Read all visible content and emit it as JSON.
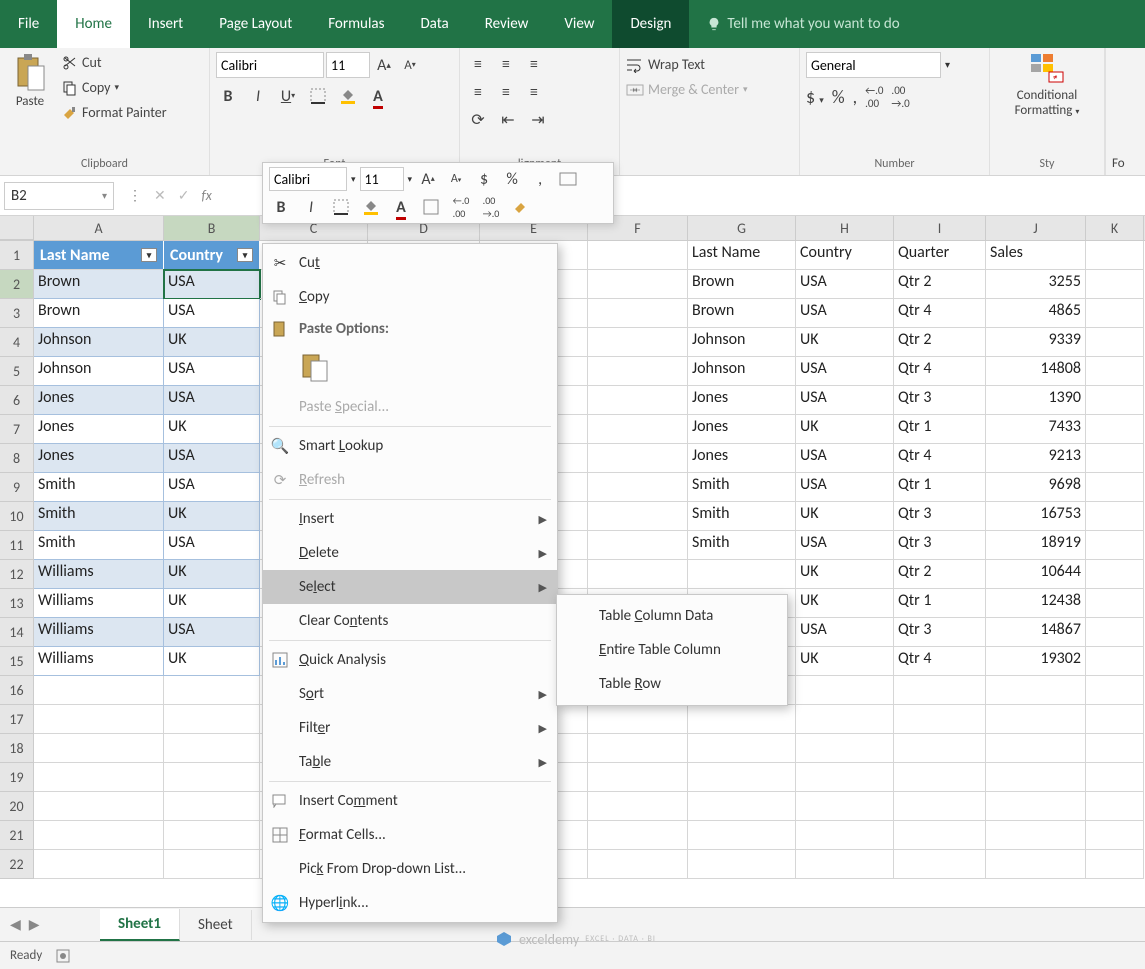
{
  "tabs": [
    "File",
    "Home",
    "Insert",
    "Page Layout",
    "Formulas",
    "Data",
    "Review",
    "View",
    "Design"
  ],
  "tellme": "Tell me what you want to do",
  "clipboard": {
    "paste": "Paste",
    "cut": "Cut",
    "copy": "Copy",
    "format_painter": "Format Painter",
    "group": "Clipboard"
  },
  "font": {
    "name": "Calibri",
    "size": "11",
    "group": "Font"
  },
  "alignment_group": "lignment",
  "wrap": {
    "wrap": "Wrap Text",
    "merge": "Merge & Center"
  },
  "number": {
    "format": "General",
    "group": "Number"
  },
  "styles": {
    "cond1": "Conditional",
    "cond2": "Formatting",
    "grp": "Sty"
  },
  "name_box": "B2",
  "table_headers": {
    "A": "Last Name",
    "B": "Country"
  },
  "table_rows": [
    {
      "A": "Brown",
      "B": "USA"
    },
    {
      "A": "Brown",
      "B": "USA"
    },
    {
      "A": "Johnson",
      "B": "UK"
    },
    {
      "A": "Johnson",
      "B": "USA"
    },
    {
      "A": "Jones",
      "B": "USA"
    },
    {
      "A": "Jones",
      "B": "UK"
    },
    {
      "A": "Jones",
      "B": "USA"
    },
    {
      "A": "Smith",
      "B": "USA"
    },
    {
      "A": "Smith",
      "B": "UK"
    },
    {
      "A": "Smith",
      "B": "USA"
    },
    {
      "A": "Williams",
      "B": "UK"
    },
    {
      "A": "Williams",
      "B": "UK"
    },
    {
      "A": "Williams",
      "B": "USA"
    },
    {
      "A": "Williams",
      "B": "UK"
    }
  ],
  "plain_headers": {
    "F": "Last Name",
    "G": "Country",
    "H": "Quarter",
    "I": "Sales"
  },
  "plain_rows": [
    {
      "F": "Brown",
      "G": "USA",
      "H": "Qtr 2",
      "I": "3255"
    },
    {
      "F": "Brown",
      "G": "USA",
      "H": "Qtr 4",
      "I": "4865"
    },
    {
      "F": "Johnson",
      "G": "UK",
      "H": "Qtr 2",
      "I": "9339"
    },
    {
      "F": "Johnson",
      "G": "USA",
      "H": "Qtr 4",
      "I": "14808"
    },
    {
      "F": "Jones",
      "G": "USA",
      "H": "Qtr 3",
      "I": "1390"
    },
    {
      "F": "Jones",
      "G": "UK",
      "H": "Qtr 1",
      "I": "7433"
    },
    {
      "F": "Jones",
      "G": "USA",
      "H": "Qtr 4",
      "I": "9213"
    },
    {
      "F": "Smith",
      "G": "USA",
      "H": "Qtr 1",
      "I": "9698"
    },
    {
      "F": "Smith",
      "G": "UK",
      "H": "Qtr 3",
      "I": "16753"
    },
    {
      "F": "Smith",
      "G": "USA",
      "H": "Qtr 3",
      "I": "18919"
    },
    {
      "F": "",
      "G": "UK",
      "H": "Qtr 2",
      "I": "10644"
    },
    {
      "F": "",
      "G": "UK",
      "H": "Qtr 1",
      "I": "12438"
    },
    {
      "F": "",
      "G": "USA",
      "H": "Qtr 3",
      "I": "14867"
    },
    {
      "F": "",
      "G": "UK",
      "H": "Qtr 4",
      "I": "19302"
    }
  ],
  "cols": [
    "A",
    "B",
    "C",
    "D",
    "E",
    "F",
    "G",
    "H",
    "I",
    "J",
    "K"
  ],
  "mini": {
    "font": "Calibri",
    "size": "11"
  },
  "context": {
    "cut": "Cut",
    "copy": "Copy",
    "paste_options": "Paste Options:",
    "paste_special": "Paste Special...",
    "smart_lookup": "Smart Lookup",
    "refresh": "Refresh",
    "insert": "Insert",
    "delete": "Delete",
    "select": "Select",
    "clear": "Clear Contents",
    "quick": "Quick Analysis",
    "sort": "Sort",
    "filter": "Filter",
    "table": "Table",
    "comment": "Insert Comment",
    "format_cells": "Format Cells...",
    "pick": "Pick From Drop-down List...",
    "hyperlink": "Hyperlink..."
  },
  "submenu": {
    "col_data": "Table Column Data",
    "entire_col": "Entire Table Column",
    "row": "Table Row"
  },
  "sheets": {
    "s1": "Sheet1",
    "s2": "Sheet"
  },
  "status": "Ready",
  "watermark": "exceldemy"
}
